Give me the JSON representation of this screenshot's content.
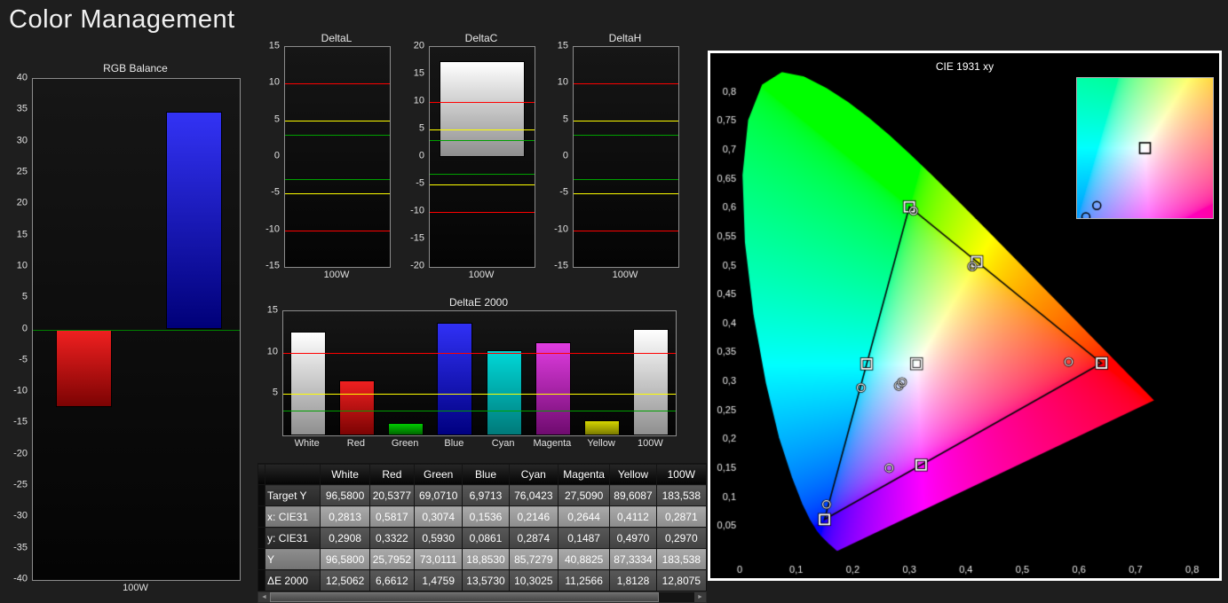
{
  "page": {
    "title": "Color Management"
  },
  "rgb_balance": {
    "title": "RGB Balance",
    "xlabel": "100W",
    "ylim": [
      -40,
      40
    ],
    "ytick_step": 5,
    "ref_lines": [
      {
        "value": 0,
        "color": "#008000"
      }
    ],
    "bars": [
      {
        "name": "red",
        "value": -12.4,
        "center": 0.245,
        "width": 0.27,
        "top": "#f02020",
        "bottom": "#7c0303"
      },
      {
        "name": "green",
        "value": 0,
        "center": 0.5,
        "width": 0.27,
        "top": "#20d020",
        "bottom": "#036a03"
      },
      {
        "name": "blue",
        "value": 34.7,
        "center": 0.78,
        "width": 0.27,
        "top": "#3333f5",
        "bottom": "#000078"
      }
    ]
  },
  "delta_charts": [
    {
      "title": "DeltaL",
      "xlabel": "100W",
      "ylim": [
        -15,
        15
      ],
      "ytick_step": 5,
      "value": 0,
      "bar_top": "#ffffff",
      "bar_bottom": "#909090",
      "ref_lines": [
        {
          "value": 10,
          "color": "#ff0000"
        },
        {
          "value": 5,
          "color": "#ffff00"
        },
        {
          "value": 3,
          "color": "#00a000"
        },
        {
          "value": -3,
          "color": "#00a000"
        },
        {
          "value": -5,
          "color": "#ffff00"
        },
        {
          "value": -10,
          "color": "#ff0000"
        }
      ]
    },
    {
      "title": "DeltaC",
      "xlabel": "100W",
      "ylim": [
        -20,
        20
      ],
      "ytick_step": 5,
      "value": 17.5,
      "bar_top": "#ffffff",
      "bar_bottom": "#8e8e8e",
      "ref_lines": [
        {
          "value": 10,
          "color": "#ff0000"
        },
        {
          "value": 5,
          "color": "#ffff00"
        },
        {
          "value": 3,
          "color": "#00a000"
        },
        {
          "value": -3,
          "color": "#00a000"
        },
        {
          "value": -5,
          "color": "#ffff00"
        },
        {
          "value": -10,
          "color": "#ff0000"
        }
      ]
    },
    {
      "title": "DeltaH",
      "xlabel": "100W",
      "ylim": [
        -15,
        15
      ],
      "ytick_step": 5,
      "value": 0,
      "bar_top": "#ffffff",
      "bar_bottom": "#909090",
      "ref_lines": [
        {
          "value": 10,
          "color": "#ff0000"
        },
        {
          "value": 5,
          "color": "#ffff00"
        },
        {
          "value": 3,
          "color": "#00a000"
        },
        {
          "value": -3,
          "color": "#00a000"
        },
        {
          "value": -5,
          "color": "#ffff00"
        },
        {
          "value": -10,
          "color": "#ff0000"
        }
      ]
    }
  ],
  "deltae_chart": {
    "title": "DeltaE 2000",
    "ylim": [
      0,
      15
    ],
    "yticks": [
      15,
      10,
      5
    ],
    "ref_lines": [
      {
        "value": 10,
        "color": "#ff0000"
      },
      {
        "value": 5,
        "color": "#ffff00"
      },
      {
        "value": 3,
        "color": "#00a000"
      }
    ],
    "categories": [
      "White",
      "Red",
      "Green",
      "Blue",
      "Cyan",
      "Magenta",
      "Yellow",
      "100W"
    ],
    "values": [
      12.5062,
      6.6612,
      1.4759,
      13.573,
      10.3025,
      11.2566,
      1.8128,
      12.8075
    ],
    "bar_colors": [
      [
        "#ffffff",
        "#8f8f8f"
      ],
      [
        "#f02020",
        "#7c0303"
      ],
      [
        "#00cc00",
        "#006600"
      ],
      [
        "#3030f5",
        "#000080"
      ],
      [
        "#00d8d8",
        "#007a7a"
      ],
      [
        "#e03ce0",
        "#6f0b6f"
      ],
      [
        "#d6d600",
        "#7a7a00"
      ],
      [
        "#ffffff",
        "#8f8f8f"
      ]
    ]
  },
  "table": {
    "columns": [
      "",
      "White",
      "Red",
      "Green",
      "Blue",
      "Cyan",
      "Magenta",
      "Yellow",
      "100W"
    ],
    "rows": [
      {
        "label": "Target Y",
        "values": [
          "96,5800",
          "20,5377",
          "69,0710",
          "6,9713",
          "76,0423",
          "27,5090",
          "89,6087",
          "183,538"
        ]
      },
      {
        "label": "x: CIE31",
        "values": [
          "0,2813",
          "0,5817",
          "0,3074",
          "0,1536",
          "0,2146",
          "0,2644",
          "0,4112",
          "0,2871"
        ]
      },
      {
        "label": "y: CIE31",
        "values": [
          "0,2908",
          "0,3322",
          "0,5930",
          "0,0861",
          "0,2874",
          "0,1487",
          "0,4970",
          "0,2970"
        ]
      },
      {
        "label": "Y",
        "values": [
          "96,5800",
          "25,7952",
          "73,0111",
          "18,8530",
          "85,7279",
          "40,8825",
          "87,3334",
          "183,538"
        ]
      },
      {
        "label": "ΔE 2000",
        "values": [
          "12,5062",
          "6,6612",
          "1,4759",
          "13,5730",
          "10,3025",
          "11,2566",
          "1,8128",
          "12,8075"
        ]
      }
    ]
  },
  "cie_chart": {
    "title": "CIE 1931 xy",
    "xlim": [
      0,
      0.8
    ],
    "ylim": [
      0,
      0.8
    ],
    "xtick_values": [
      0,
      0.1,
      0.2,
      0.3,
      0.4,
      0.5,
      0.6,
      0.7,
      0.8
    ],
    "xtick_labels": [
      "0",
      "0,1",
      "0,2",
      "0,3",
      "0,4",
      "0,5",
      "0,6",
      "0,7",
      "0,8"
    ],
    "ytick_values": [
      0.05,
      0.1,
      0.15,
      0.2,
      0.25,
      0.3,
      0.35,
      0.4,
      0.45,
      0.5,
      0.55,
      0.6,
      0.65,
      0.7,
      0.75,
      0.8
    ],
    "ytick_labels": [
      "0,05",
      "0,1",
      "0,15",
      "0,2",
      "0,25",
      "0,3",
      "0,35",
      "0,4",
      "0,45",
      "0,5",
      "0,55",
      "0,6",
      "0,65",
      "0,7",
      "0,75",
      "0,8"
    ],
    "gamut_triangle": [
      [
        0.64,
        0.33
      ],
      [
        0.3,
        0.6
      ],
      [
        0.15,
        0.06
      ]
    ],
    "reference_points": [
      {
        "name": "white",
        "x": 0.3127,
        "y": 0.329
      },
      {
        "name": "red",
        "x": 0.64,
        "y": 0.33
      },
      {
        "name": "green",
        "x": 0.3,
        "y": 0.6
      },
      {
        "name": "blue",
        "x": 0.15,
        "y": 0.06
      },
      {
        "name": "cyan",
        "x": 0.2246,
        "y": 0.3287
      },
      {
        "name": "magenta",
        "x": 0.3209,
        "y": 0.1542
      },
      {
        "name": "yellow",
        "x": 0.4193,
        "y": 0.5053
      }
    ],
    "measured_points": [
      {
        "name": "White",
        "x": 0.2813,
        "y": 0.2908
      },
      {
        "name": "Red",
        "x": 0.5817,
        "y": 0.3322
      },
      {
        "name": "Green",
        "x": 0.3074,
        "y": 0.593
      },
      {
        "name": "Blue",
        "x": 0.1536,
        "y": 0.0861
      },
      {
        "name": "Cyan",
        "x": 0.2146,
        "y": 0.2874
      },
      {
        "name": "Magenta",
        "x": 0.2644,
        "y": 0.1487
      },
      {
        "name": "Yellow",
        "x": 0.4112,
        "y": 0.497
      },
      {
        "name": "100W",
        "x": 0.2871,
        "y": 0.297
      }
    ],
    "inset": {
      "x_range": [
        0.2766,
        0.3488
      ],
      "y_range": [
        0.29,
        0.368
      ]
    }
  },
  "scrollbar": {
    "left_arrow": "◄",
    "right_arrow": "►"
  }
}
